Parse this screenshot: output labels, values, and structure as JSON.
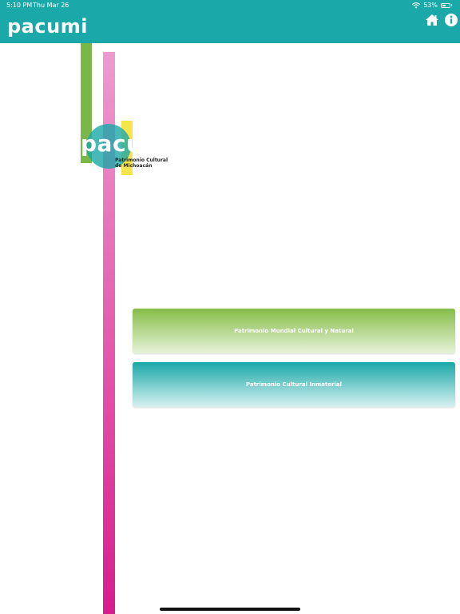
{
  "status": {
    "time": "5:10 PM",
    "date": "Thu Mar 26",
    "battery": "53%",
    "battery_level": 0.53
  },
  "header": {
    "title": "pacumi",
    "home_icon": "home-icon",
    "info_icon": "info-icon"
  },
  "logo": {
    "word": "pacumi",
    "line1": "Patrimonio Cultural",
    "line2": "de Michoacán"
  },
  "menu": {
    "items": [
      {
        "label": "Patrimonio Mundial Cultural y Natural"
      },
      {
        "label": "Patrimonio Cultural Inmaterial"
      }
    ]
  },
  "colors": {
    "brand_teal": "#1aa8a8",
    "green": "#7ab648",
    "pink": "#d61d8c",
    "yellow": "#f5e44a"
  }
}
